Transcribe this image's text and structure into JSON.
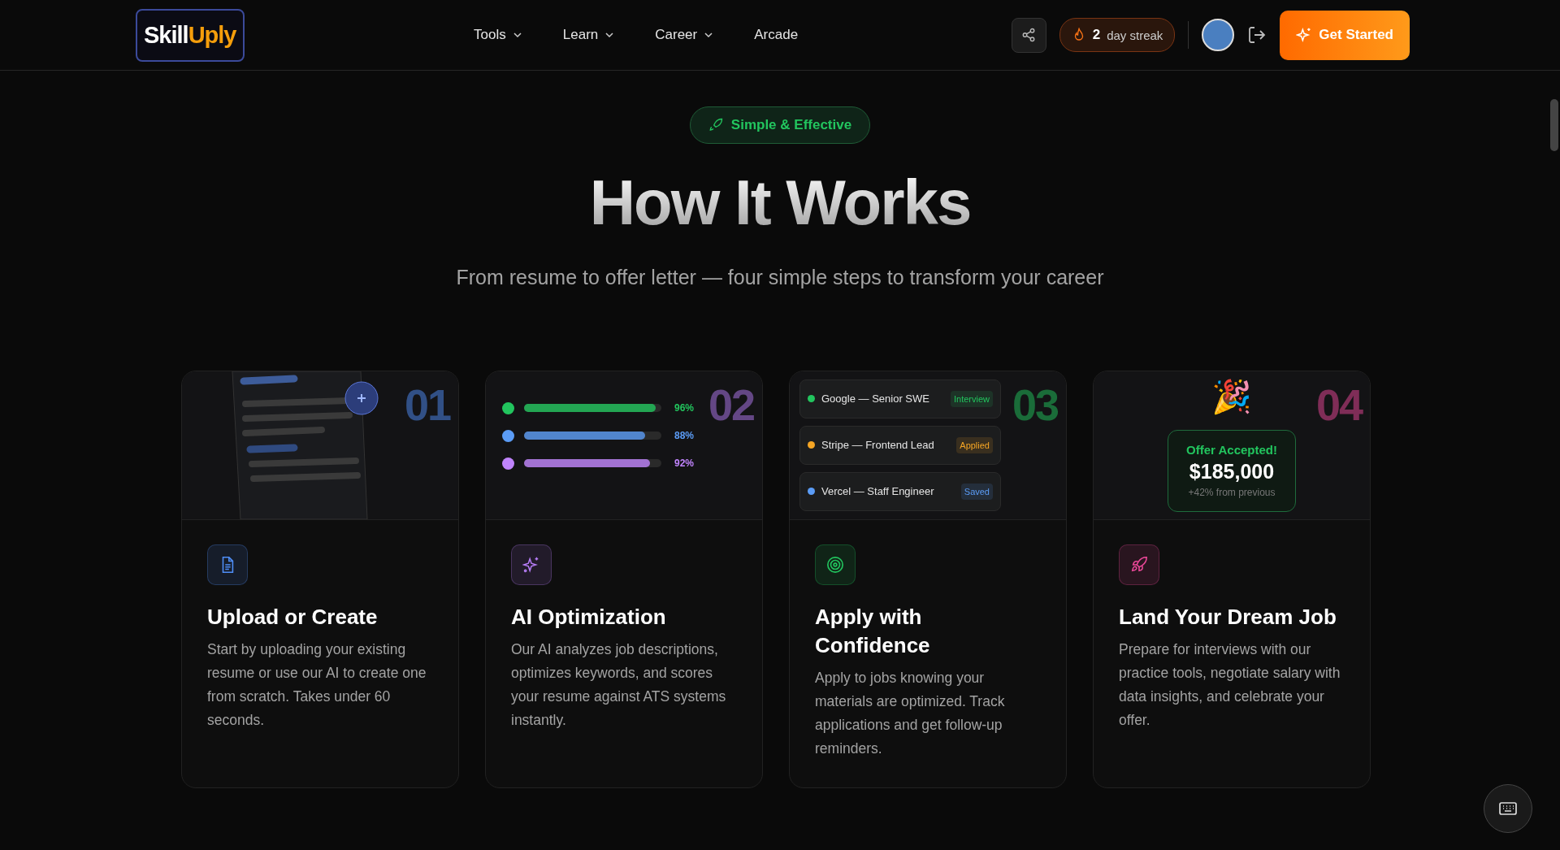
{
  "header": {
    "logo": {
      "first": "Skill",
      "second": "Uply"
    },
    "nav": [
      {
        "label": "Tools",
        "has_menu": true
      },
      {
        "label": "Learn",
        "has_menu": true
      },
      {
        "label": "Career",
        "has_menu": true
      },
      {
        "label": "Arcade",
        "has_menu": false
      }
    ],
    "streak": {
      "count": "2",
      "label": "day streak"
    },
    "cta": "Get Started"
  },
  "hero": {
    "badge": "Simple & Effective",
    "title": "How It Works",
    "subtitle": "From resume to offer letter — four simple steps to transform your career"
  },
  "steps": [
    {
      "number": "01",
      "kind": "document",
      "color": "#4f8ef7",
      "title": "Upload or Create",
      "description": "Start by uploading your existing resume or use our AI to create one from scratch. Takes under 60 seconds."
    },
    {
      "number": "02",
      "kind": "scores",
      "color": "#b57cf5",
      "title": "AI Optimization",
      "description": "Our AI analyzes job descriptions, optimizes keywords, and scores your resume against ATS systems instantly.",
      "scores": [
        {
          "level": 0.96,
          "reading": "96%",
          "color": "#22c55e"
        },
        {
          "level": 0.88,
          "reading": "88%",
          "color": "#5b9cf6"
        },
        {
          "level": 0.92,
          "reading": "92%",
          "color": "#c084fc"
        }
      ]
    },
    {
      "number": "03",
      "kind": "jobs",
      "color": "#22c55e",
      "title": "Apply with Confidence",
      "description": "Apply to jobs knowing your materials are optimized. Track applications and get follow-up reminders.",
      "jobs": [
        {
          "name": "Google — Senior SWE",
          "status": "Interview",
          "color": "#22c55e"
        },
        {
          "name": "Stripe — Frontend Lead",
          "status": "Applied",
          "color": "#f5a524"
        },
        {
          "name": "Vercel — Staff Engineer",
          "status": "Saved",
          "color": "#5b9cf6"
        }
      ]
    },
    {
      "number": "04",
      "kind": "offer",
      "color": "#ec4899",
      "title": "Land Your Dream Job",
      "description": "Prepare for interviews with our practice tools, negotiate salary with data insights, and celebrate your offer.",
      "offer": {
        "emoji": "🎉",
        "label": "Offer Accepted!",
        "amount": "$185,000",
        "note": "+42% from previous"
      }
    }
  ]
}
